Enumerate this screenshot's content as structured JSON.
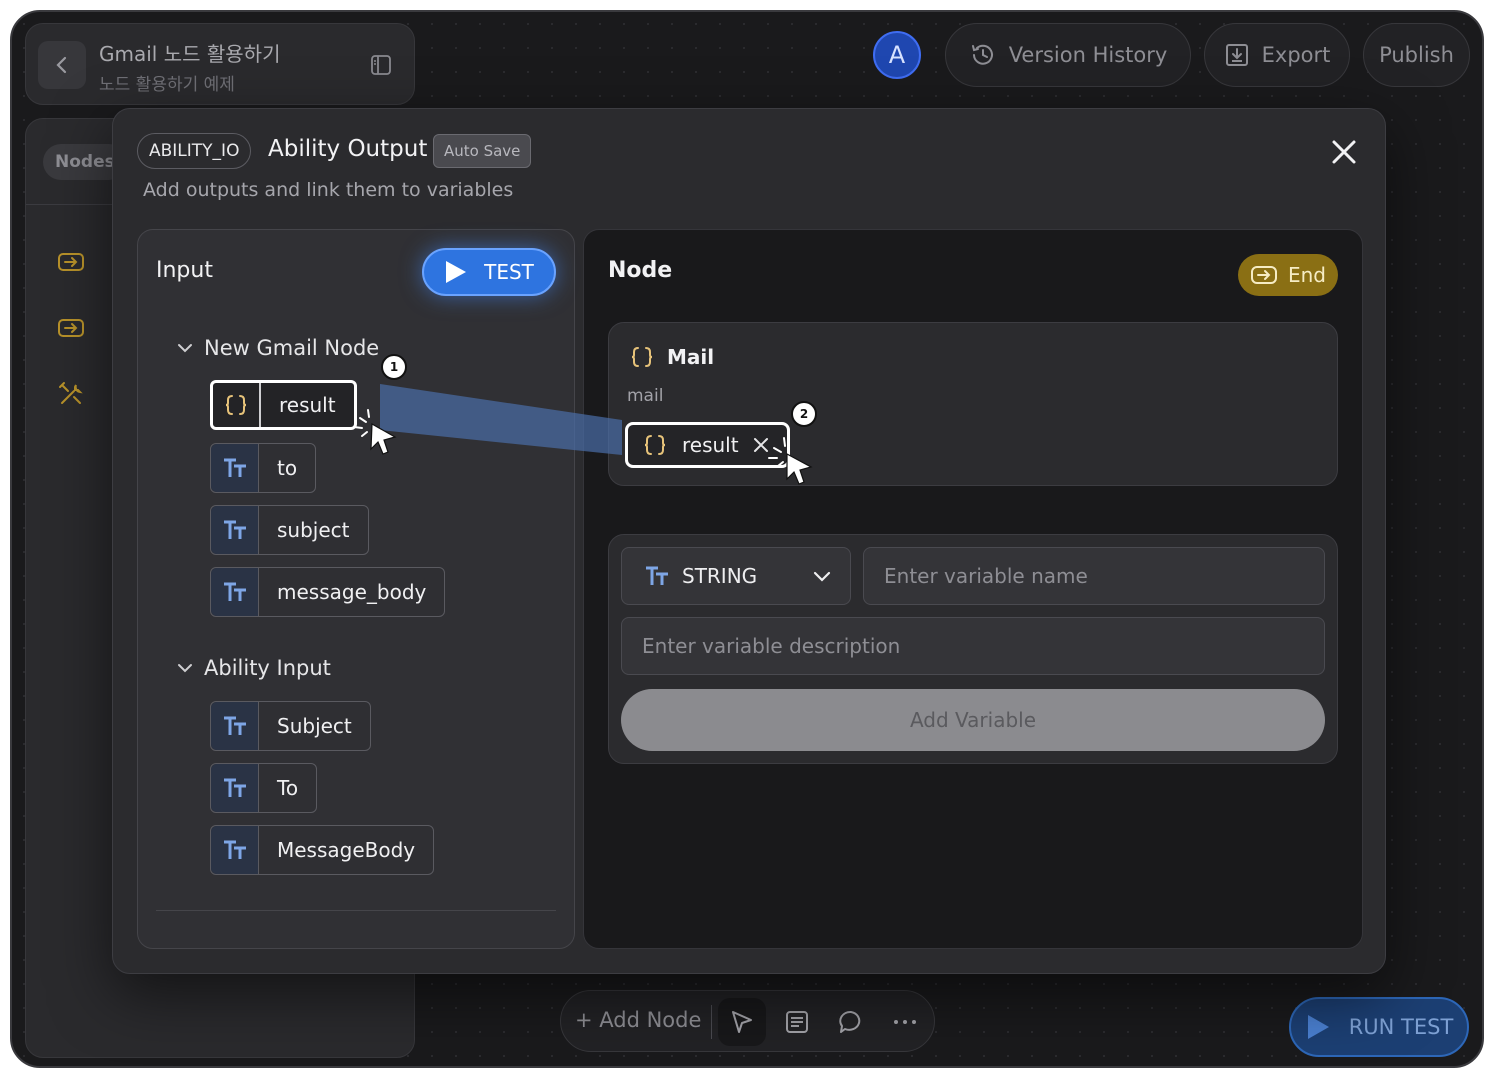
{
  "header": {
    "title": "Gmail 노드 활용하기",
    "subtitle": "노드 활용하기 예제",
    "avatar_initial": "A",
    "version_history_label": "Version History",
    "export_label": "Export",
    "publish_label": "Publish"
  },
  "sidebar": {
    "tab_label": "Nodes"
  },
  "modal": {
    "badge": "ABILITY_IO",
    "title": "Ability Output",
    "autosave_label": "Auto Save",
    "subtitle": "Add outputs and link them to variables",
    "input_panel": {
      "heading": "Input",
      "test_label": "TEST",
      "groups": [
        {
          "title": "New Gmail Node",
          "items": [
            {
              "label": "result",
              "type_icon": "braces-icon"
            },
            {
              "label": "to",
              "type_icon": "text-type-icon"
            },
            {
              "label": "subject",
              "type_icon": "text-type-icon"
            },
            {
              "label": "message_body",
              "type_icon": "text-type-icon"
            }
          ]
        },
        {
          "title": "Ability Input",
          "items": [
            {
              "label": "Subject",
              "type_icon": "text-type-icon"
            },
            {
              "label": "To",
              "type_icon": "text-type-icon"
            },
            {
              "label": "MessageBody",
              "type_icon": "text-type-icon"
            }
          ]
        }
      ]
    },
    "node_panel": {
      "heading": "Node",
      "end_label": "End",
      "mail_card": {
        "title": "Mail",
        "key": "mail",
        "linked_variable": "result"
      },
      "form": {
        "type_selected": "STRING",
        "name_placeholder": "Enter variable name",
        "description_placeholder": "Enter variable description",
        "add_button_label": "Add Variable"
      }
    },
    "steps": [
      "1",
      "2"
    ]
  },
  "toolbar": {
    "add_node_label": "+ Add Node"
  },
  "run_test_label": "RUN TEST",
  "colors": {
    "accent_blue": "#2e74e0",
    "end_gold": "#8a6f14",
    "background": "#1a1a1c"
  }
}
